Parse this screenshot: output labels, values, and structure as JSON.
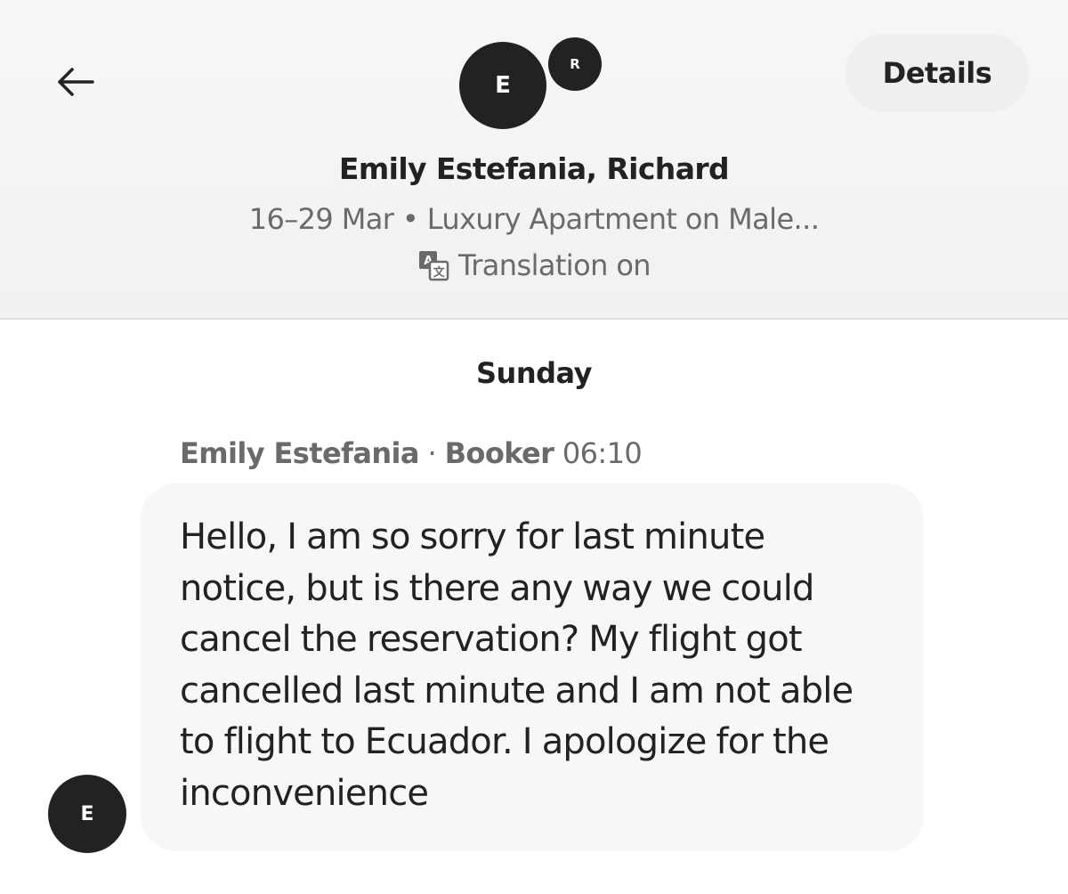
{
  "header": {
    "back_icon": "arrow-left-icon",
    "details_label": "Details",
    "avatars": [
      "E",
      "R"
    ],
    "title": "Emily Estefania, Richard",
    "subtitle": "16–29 Mar • Luxury Apartment on Male...",
    "translation_icon": "translate-icon",
    "translation_label": "Translation on"
  },
  "conversation": {
    "day_label": "Sunday",
    "messages": [
      {
        "sender_name": "Emily Estefania",
        "separator": " · ",
        "sender_role": "Booker",
        "time": "06:10",
        "avatar_initial": "E",
        "text": "Hello, I am so sorry for last minute notice, but is there any way we could cancel the reservation? My flight got cancelled last minute and I am not able to flight to Ecuador. I apologize for the inconvenience"
      }
    ]
  },
  "colors": {
    "text_primary": "#222222",
    "text_secondary": "#6a6a6a",
    "avatar_bg": "#222222",
    "bubble_bg": "#f7f7f7",
    "header_bg": "#f4f4f4"
  }
}
